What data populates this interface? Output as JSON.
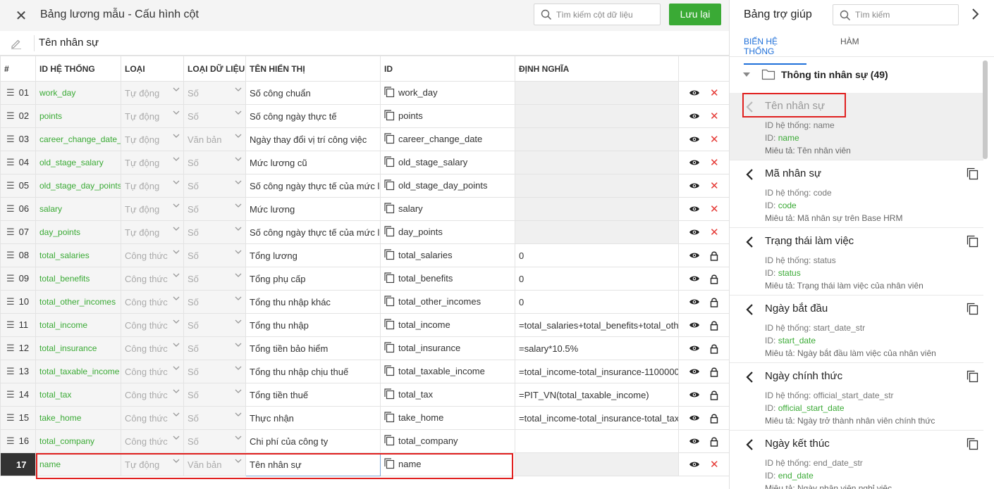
{
  "header": {
    "title": "Bảng lương mẫu - Cấu hình cột",
    "search_placeholder": "Tìm kiếm cột dữ liệu",
    "save_label": "Lưu lại"
  },
  "name_field": "Tên nhân sự",
  "columns": [
    "#",
    "ID HỆ THỐNG",
    "LOẠI",
    "LOẠI DỮ LIỆU",
    "TÊN HIỂN THỊ",
    "ID",
    "ĐỊNH NGHĨA"
  ],
  "rows": [
    {
      "num": "01",
      "sys": "work_day",
      "type": "Tự động",
      "dtype": "Số",
      "display": "Số công chuẩn",
      "id": "work_day",
      "def": "",
      "locked": false
    },
    {
      "num": "02",
      "sys": "points",
      "type": "Tự động",
      "dtype": "Số",
      "display": "Số công ngày thực tế",
      "id": "points",
      "def": "",
      "locked": false
    },
    {
      "num": "03",
      "sys": "career_change_date_",
      "type": "Tự động",
      "dtype": "Văn bản",
      "display": "Ngày thay đổi vị trí công việc",
      "id": "career_change_date",
      "def": "",
      "locked": false
    },
    {
      "num": "04",
      "sys": "old_stage_salary",
      "type": "Tự động",
      "dtype": "Số",
      "display": "Mức lương cũ",
      "id": "old_stage_salary",
      "def": "",
      "locked": false
    },
    {
      "num": "05",
      "sys": "old_stage_day_points",
      "type": "Tự động",
      "dtype": "Số",
      "display": "Số công ngày thực tế của mức l",
      "id": "old_stage_day_points",
      "def": "",
      "locked": false
    },
    {
      "num": "06",
      "sys": "salary",
      "type": "Tự động",
      "dtype": "Số",
      "display": "Mức lương",
      "id": "salary",
      "def": "",
      "locked": false
    },
    {
      "num": "07",
      "sys": "day_points",
      "type": "Tự động",
      "dtype": "Số",
      "display": "Số công ngày thực tế của mức l",
      "id": "day_points",
      "def": "",
      "locked": false
    },
    {
      "num": "08",
      "sys": "total_salaries",
      "type": "Công thức",
      "dtype": "Số",
      "display": "Tổng lương",
      "id": "total_salaries",
      "def": "0",
      "locked": true
    },
    {
      "num": "09",
      "sys": "total_benefits",
      "type": "Công thức",
      "dtype": "Số",
      "display": "Tổng phụ cấp",
      "id": "total_benefits",
      "def": "0",
      "locked": true
    },
    {
      "num": "10",
      "sys": "total_other_incomes",
      "type": "Công thức",
      "dtype": "Số",
      "display": "Tổng thu nhập khác",
      "id": "total_other_incomes",
      "def": "0",
      "locked": true
    },
    {
      "num": "11",
      "sys": "total_income",
      "type": "Công thức",
      "dtype": "Số",
      "display": "Tổng thu nhập",
      "id": "total_income",
      "def": "=total_salaries+total_benefits+total_oth",
      "locked": true
    },
    {
      "num": "12",
      "sys": "total_insurance",
      "type": "Công thức",
      "dtype": "Số",
      "display": "Tổng tiền bảo hiểm",
      "id": "total_insurance",
      "def": "=salary*10.5%",
      "locked": true
    },
    {
      "num": "13",
      "sys": "total_taxable_income",
      "type": "Công thức",
      "dtype": "Số",
      "display": "Tổng thu nhập chịu thuế",
      "id": "total_taxable_income",
      "def": "=total_income-total_insurance-1100000",
      "locked": true
    },
    {
      "num": "14",
      "sys": "total_tax",
      "type": "Công thức",
      "dtype": "Số",
      "display": "Tổng tiền thuế",
      "id": "total_tax",
      "def": "=PIT_VN(total_taxable_income)",
      "locked": true
    },
    {
      "num": "15",
      "sys": "take_home",
      "type": "Công thức",
      "dtype": "Số",
      "display": "Thực nhận",
      "id": "take_home",
      "def": "=total_income-total_insurance-total_tax",
      "locked": true
    },
    {
      "num": "16",
      "sys": "total_company",
      "type": "Công thức",
      "dtype": "Số",
      "display": "Chi phí của công ty",
      "id": "total_company",
      "def": "",
      "locked": true
    },
    {
      "num": "17",
      "sys": "name",
      "type": "Tự động",
      "dtype": "Văn bản",
      "display": "Tên nhân sự",
      "id": "name",
      "def": "",
      "locked": false
    }
  ],
  "help": {
    "title": "Bảng trợ giúp",
    "search_placeholder": "Tìm kiếm",
    "tabs": [
      "BIẾN HỆ THỐNG",
      "HÀM"
    ],
    "group": "Thông tin nhân sự (49)",
    "items": [
      {
        "name": "Tên nhân sự",
        "sys_label": "ID hệ thống: name",
        "id_label": "ID:",
        "id": "name",
        "desc": "Miêu tả: Tên nhân viên"
      },
      {
        "name": "Mã nhân sự",
        "sys_label": "ID hệ thống: code",
        "id_label": "ID:",
        "id": "code",
        "desc": "Miêu tả: Mã nhân sự trên Base HRM"
      },
      {
        "name": "Trạng thái làm việc",
        "sys_label": "ID hệ thống: status",
        "id_label": "ID:",
        "id": "status",
        "desc": "Miêu tả: Trạng thái làm việc của nhân viên"
      },
      {
        "name": "Ngày bắt đầu",
        "sys_label": "ID hệ thống: start_date_str",
        "id_label": "ID:",
        "id": "start_date",
        "desc": "Miêu tả: Ngày bắt đầu làm việc của nhân viên"
      },
      {
        "name": "Ngày chính thức",
        "sys_label": "ID hệ thống: official_start_date_str",
        "id_label": "ID:",
        "id": "official_start_date",
        "desc": "Miêu tả: Ngày trở thành nhân viên chính thức"
      },
      {
        "name": "Ngày kết thúc",
        "sys_label": "ID hệ thống: end_date_str",
        "id_label": "ID:",
        "id": "end_date",
        "desc": "Miêu tả: Ngày nhân viên nghỉ việc"
      }
    ]
  },
  "colors": {
    "accent_green": "#3aaa35",
    "link_blue": "#1e6fd9",
    "delete_red": "#e53935",
    "highlight_red": "#e0201f"
  }
}
